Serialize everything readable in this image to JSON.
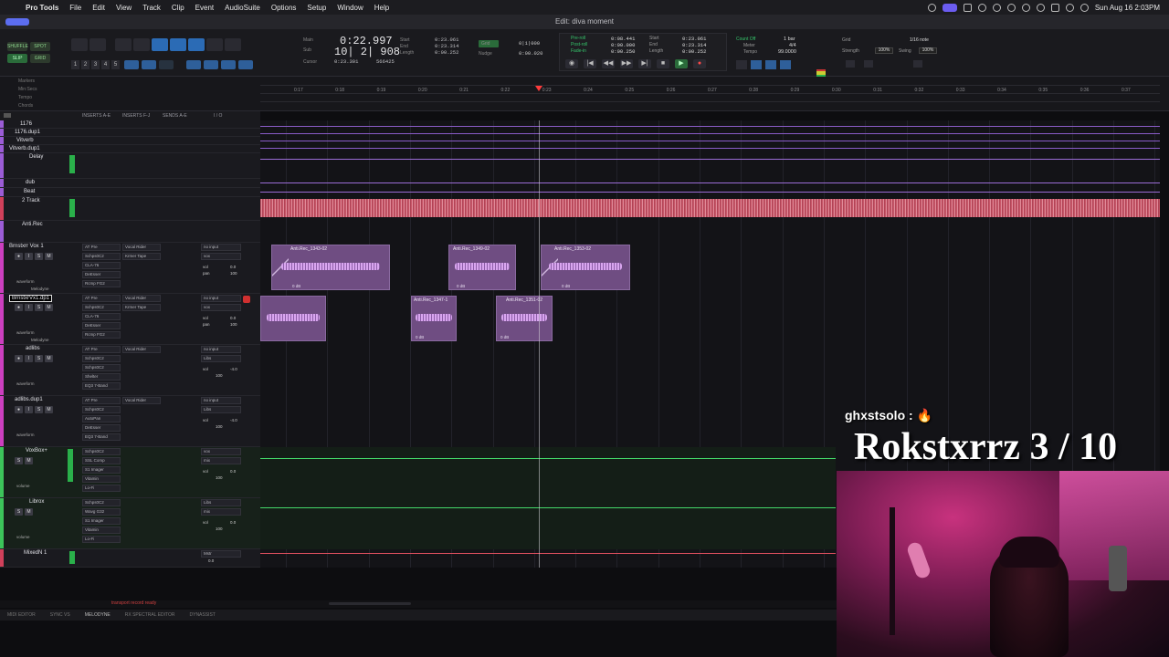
{
  "menubar": {
    "app": "Pro Tools",
    "items": [
      "File",
      "Edit",
      "View",
      "Track",
      "Clip",
      "Event",
      "AudioSuite",
      "Options",
      "Setup",
      "Window",
      "Help"
    ],
    "clock": "Sun Aug 16  2:03PM"
  },
  "window": {
    "title": "Edit: diva moment"
  },
  "toolbar": {
    "modes": [
      "SHUFFLE",
      "SPOT",
      "SLIP",
      "GRID"
    ],
    "zoom_presets": [
      "1",
      "2",
      "3",
      "4",
      "5"
    ],
    "main_label": "Main",
    "main_counter": "0:22.997",
    "sub_label": "Sub",
    "sub_counter": "10| 2| 908",
    "cursor_label": "Cursor",
    "cursor_value": "0:23.301",
    "sel_start_label": "Start",
    "sel_start": "0:23.061",
    "sel_end_label": "End",
    "sel_end": "0:23.314",
    "sel_length_label": "Length",
    "sel_length": "0:00.252",
    "samples": "566425",
    "nudge_grid_label": "Grid",
    "nudge_grid": "0|1|000",
    "nudge_label": "Nudge",
    "nudge_value": "0:00.020"
  },
  "transport": {
    "preroll_label": "Pre-roll",
    "preroll": "0:08.441",
    "postroll_label": "Post-roll",
    "postroll": "0:00.000",
    "fadein_label": "Fade-in",
    "fadein": "0:00.250",
    "start_label": "Start",
    "start": "0:23.061",
    "end_label": "End",
    "end": "0:23.314",
    "length_label": "Length",
    "length": "0:00.252",
    "countoff_label": "Count Off",
    "countoff": "1 bar",
    "meter_label": "Meter",
    "meter": "4/4",
    "tempo_label": "Tempo",
    "tempo": "99.0000",
    "grid_label": "Grid",
    "grid_value": "1/16 note",
    "strength_label": "Strength",
    "strength": "100%",
    "swing_label": "Swing",
    "swing": "100%"
  },
  "rulers": {
    "labels": [
      "Markers",
      "Min:Secs",
      "Tempo",
      "Chords"
    ],
    "ticks": [
      "0:17",
      "0:18",
      "0:19",
      "0:20",
      "0:21",
      "0:22",
      "0:23",
      "0:24",
      "0:25",
      "0:26",
      "0:27",
      "0:28",
      "0:29",
      "0:30",
      "0:31",
      "0:32",
      "0:33",
      "0:34",
      "0:35",
      "0:36",
      "0:37"
    ]
  },
  "column_headers": {
    "inserts_ae": "INSERTS A-E",
    "inserts_fj": "INSERTS F-J",
    "sends_ae": "SENDS A-E",
    "io": "I / O"
  },
  "tracks": [
    {
      "name": "1176",
      "color": "#9b5cd6"
    },
    {
      "name": "1176.dup1",
      "color": "#9b5cd6"
    },
    {
      "name": "Vitverb",
      "color": "#9b5cd6"
    },
    {
      "name": "Vitverb.dup1",
      "color": "#9b5cd6"
    },
    {
      "name": "Delay",
      "color": "#9b5cd6"
    },
    {
      "name": "dub",
      "color": "#9b5cd6"
    },
    {
      "name": "Beat",
      "color": "#9b5cd6"
    },
    {
      "name": "2 Track",
      "color": "#d0405a"
    },
    {
      "name": "Anti.Rec",
      "color": "#9b5cd6"
    },
    {
      "name": "Brnstxrr Vox 1",
      "color": "#cc3fbf"
    },
    {
      "name": "BrnstxrVx1.dp1",
      "color": "#cc3fbf"
    },
    {
      "name": "adlibs",
      "color": "#cc3fbf"
    },
    {
      "name": "adlibs.dup1",
      "color": "#cc3fbf"
    },
    {
      "name": "VoxBox+",
      "color": "#3cc45a"
    },
    {
      "name": "Librox",
      "color": "#3cc45a"
    },
    {
      "name": "MixedN 1",
      "color": "#d0405a"
    }
  ],
  "plugins": {
    "vox": [
      "AT Pre",
      "Schps0C2",
      "CLA-76",
      "DeEsser",
      "Rcmp FG2"
    ],
    "vox_sends": [
      "Vocal Rider",
      "Krmer Tape"
    ],
    "vox2": [
      "AT Pre",
      "Schps0C2",
      "CLA-76",
      "DeEsser",
      "Rcmp FG2"
    ],
    "adlibs": [
      "AT Pre",
      "Schps0C2",
      "Schps0C2",
      "Shelter",
      "EQ3 7-Band"
    ],
    "adlibs2": [
      "AT Pre",
      "Schps0C2",
      "AutoPan",
      "DeEsser",
      "EQ3 7-Band"
    ],
    "voxbox": [
      "Schps0C2",
      "SSL Comp",
      "S1 Imager",
      "Vitamin",
      "Lo-Fi"
    ],
    "librox": [
      "Schps0C2",
      "Wavg G32",
      "S1 Imager",
      "Vitamin",
      "Lo-Fi"
    ],
    "vocal_rider_label": "Vocal Rider",
    "waveform_label": "waveform",
    "volume_label": "volume",
    "melodyne_label": "Melodyne"
  },
  "io": {
    "no_input": "no input",
    "vox": "vox",
    "libs": "Libs",
    "mix": "mix",
    "vol": "vol",
    "pan": "pan",
    "vol_vox": "0.0",
    "vol_adlibs": "-4.0",
    "pan_value": "100",
    "mixedn_out": "Mstr"
  },
  "clips": [
    {
      "name": "Anti.Rec_1343-02",
      "gain": "0 dB"
    },
    {
      "name": "Anti.Rec_1349-02",
      "gain": "0 dB"
    },
    {
      "name": "Anti.Rec_1353-02",
      "gain": "0 dB"
    },
    {
      "name": "Anti.Rec_1347-1",
      "gain": "0 dB"
    },
    {
      "name": "Anti.Rec_1351-02",
      "gain": "0 dB"
    }
  ],
  "status": {
    "transport_msg": "transport record ready"
  },
  "bottom_tabs": [
    "MIDI EDITOR",
    "SYNC VS",
    "MELODYNE",
    "RX SPECTRAL EDITOR",
    "DYNASSIST"
  ],
  "overlay": {
    "username": "ghxstsolo : 🔥",
    "rating": "Rokstxrrz 3 / 10"
  },
  "colors": {
    "accent_blue": "#2b6bb5",
    "record_red": "#ff3b3b",
    "clip_purple": "#6f4d82",
    "two_track_red": "#c85668",
    "green_meter": "#2ab04a"
  }
}
